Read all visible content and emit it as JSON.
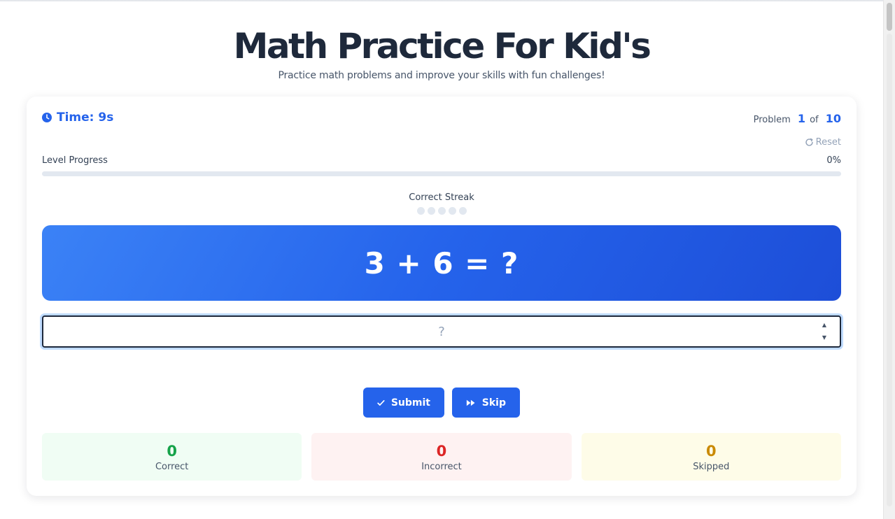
{
  "header": {
    "title": "Math Practice For Kid's",
    "subtitle": "Practice math problems and improve your skills with fun challenges!"
  },
  "timer": {
    "icon": "clock-icon",
    "label": "Time: 9s"
  },
  "problem_counter": {
    "prefix": "Problem",
    "current": "1",
    "of": "of",
    "total": "10"
  },
  "reset": {
    "icon": "refresh-icon",
    "label": "Reset"
  },
  "level_progress": {
    "label": "Level Progress",
    "percent_text": "0%",
    "value": 0
  },
  "streak": {
    "label": "Correct Streak",
    "dots_total": 5,
    "dots_filled": 0
  },
  "problem": {
    "text": "3 + 6 = ?"
  },
  "answer": {
    "value": "",
    "placeholder": "?"
  },
  "buttons": {
    "submit": {
      "icon": "check-icon",
      "label": "Submit"
    },
    "skip": {
      "icon": "fast-forward-icon",
      "label": "Skip"
    }
  },
  "stats": {
    "correct": {
      "value": "0",
      "label": "Correct"
    },
    "incorrect": {
      "value": "0",
      "label": "Incorrect"
    },
    "skipped": {
      "value": "0",
      "label": "Skipped"
    }
  },
  "colors": {
    "accent": "#2563eb",
    "correct": "#16a34a",
    "incorrect": "#dc2626",
    "skipped": "#ca8a04"
  }
}
